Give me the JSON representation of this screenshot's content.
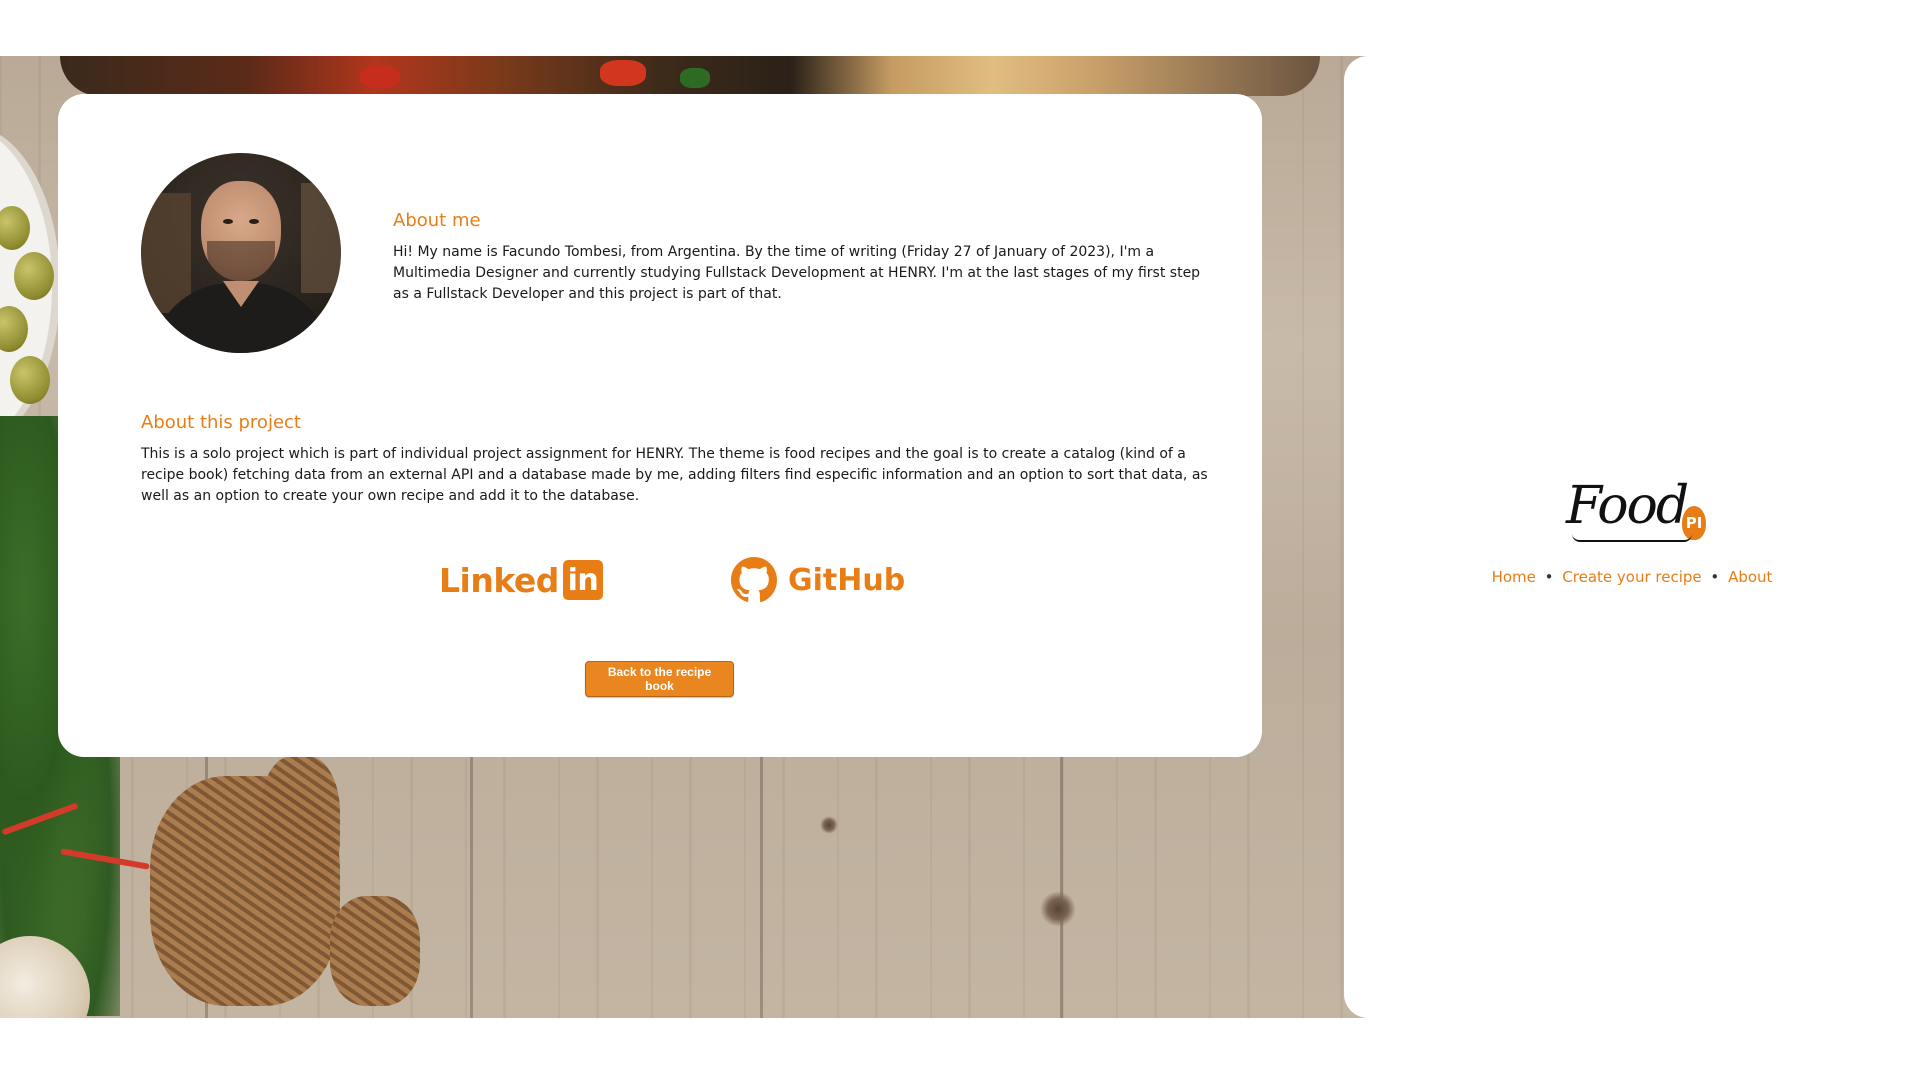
{
  "about_me": {
    "title": "About me",
    "text": "Hi! My name is Facundo Tombesi, from Argentina. By the time of writing (Friday 27 of January of 2023), I'm a Multimedia Designer and currently studying Fullstack Development at HENRY. I'm at the last stages of my first step as a Fullstack Developer and this project is part of that."
  },
  "about_project": {
    "title": "About this project",
    "text": "This is a solo project which is part of individual project assignment for HENRY. The theme is food recipes and the goal is to create a catalog (kind of a recipe book) fetching data from an external API and a database made by me, adding filters find especific information and an option to sort that data, as well as an option to create your own recipe and add it to the database."
  },
  "social": {
    "linkedin_label": "Linked",
    "linkedin_box": "in",
    "github_label": "GitHub"
  },
  "back_button": "Back to the recipe book",
  "side": {
    "logo_text": "Food",
    "logo_badge": "PI",
    "nav": {
      "home": "Home",
      "separator": "•",
      "create": "Create your recipe",
      "about": "About"
    }
  },
  "colors": {
    "accent": "#e87d16",
    "button": "#e9861f",
    "text": "#1a1a1a"
  }
}
